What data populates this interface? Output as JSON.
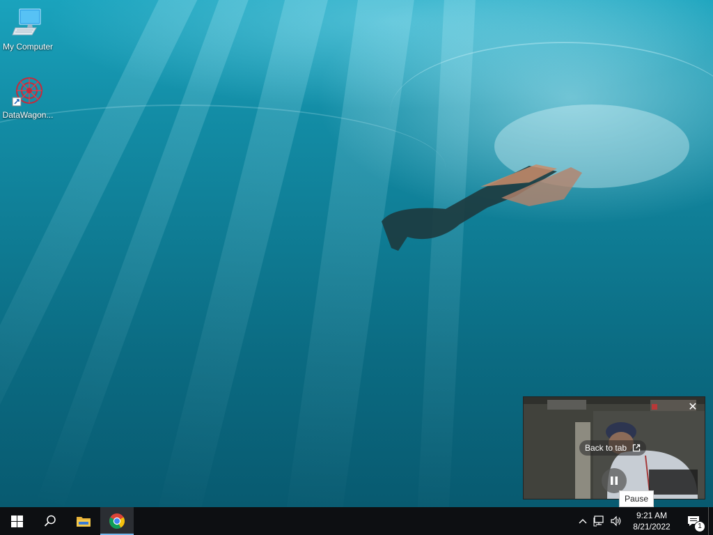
{
  "desktop": {
    "icons": [
      {
        "label": "My Computer",
        "icon": "computer-icon"
      },
      {
        "label": "DataWagon...",
        "icon": "datawagon-app-icon"
      }
    ]
  },
  "pip": {
    "back_to_tab_label": "Back to tab",
    "tooltip": "Pause",
    "icons": {
      "close": "close-icon",
      "open_in_tab": "open-in-tab-icon",
      "pause": "pause-icon"
    }
  },
  "taskbar": {
    "items": [
      {
        "name": "Start",
        "icon": "windows-start-icon"
      },
      {
        "name": "Search",
        "icon": "search-icon"
      },
      {
        "name": "File Explorer",
        "icon": "folder-icon"
      },
      {
        "name": "Google Chrome",
        "icon": "chrome-icon",
        "active": true
      }
    ],
    "tray": {
      "icons": [
        "chevron-up-icon",
        "network-icon",
        "volume-icon"
      ],
      "time": "9:21 AM",
      "date": "8/21/2022",
      "notification_count": "1"
    }
  },
  "colors": {
    "taskbar": "#0d0f12",
    "accent": "#76b9ed",
    "water_light": "#1aa3bd",
    "water_dark": "#085a70"
  }
}
